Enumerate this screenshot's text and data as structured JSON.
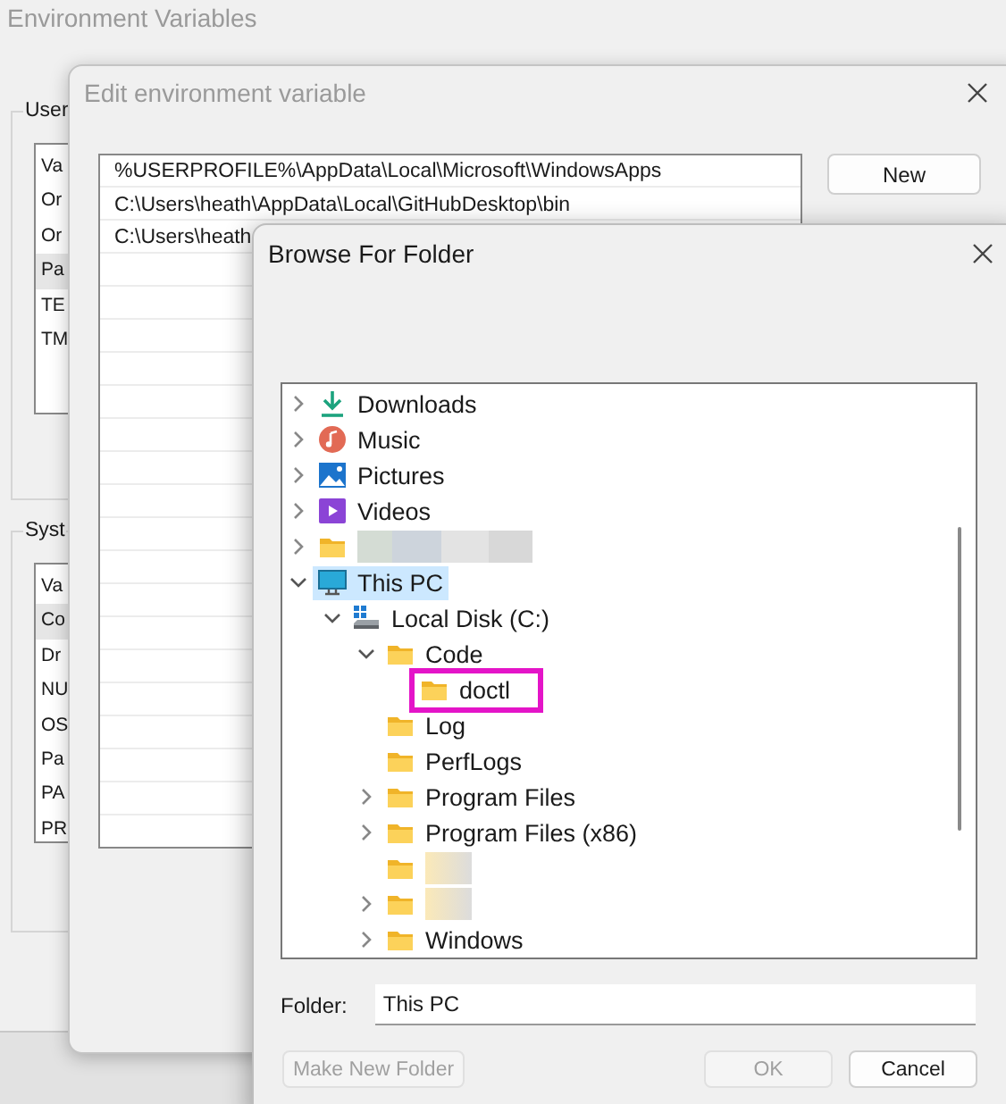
{
  "background_window": {
    "title": "Environment Variables",
    "user_group": {
      "label": "User",
      "header": "Va",
      "rows": [
        {
          "text": "Or",
          "selected": false
        },
        {
          "text": "Or",
          "selected": false
        },
        {
          "text": "Pa",
          "selected": true
        },
        {
          "text": "TE",
          "selected": false
        },
        {
          "text": "TM",
          "selected": false
        }
      ]
    },
    "system_group": {
      "label": "Syst",
      "header": "Va",
      "rows": [
        {
          "text": "Co",
          "selected": true
        },
        {
          "text": "Dr",
          "selected": false
        },
        {
          "text": "NU",
          "selected": false
        },
        {
          "text": "OS",
          "selected": false
        },
        {
          "text": "Pa",
          "selected": false
        },
        {
          "text": "PA",
          "selected": false
        },
        {
          "text": "PR",
          "selected": false
        }
      ]
    }
  },
  "edit_window": {
    "title": "Edit environment variable",
    "entries": [
      {
        "text": "%USERPROFILE%\\AppData\\Local\\Microsoft\\WindowsApps",
        "selected": false
      },
      {
        "text": "C:\\Users\\heath\\AppData\\Local\\GitHubDesktop\\bin",
        "selected": false
      },
      {
        "text": "C:\\Users\\heath",
        "selected": false
      }
    ],
    "buttons": [
      {
        "label": "New",
        "disabled": false
      }
    ]
  },
  "browse_window": {
    "title": "Browse For Folder",
    "tree": [
      {
        "kind": "download",
        "label": "Downloads",
        "expanded": false,
        "selected": false
      },
      {
        "kind": "music",
        "label": "Music",
        "expanded": false,
        "selected": false
      },
      {
        "kind": "pictures",
        "label": "Pictures",
        "expanded": false,
        "selected": false
      },
      {
        "kind": "videos",
        "label": "Videos",
        "expanded": false,
        "selected": false
      },
      {
        "kind": "redacted",
        "expanded": false,
        "selected": false
      },
      {
        "kind": "pc",
        "label": "This PC",
        "expanded": true,
        "selected": true,
        "children": [
          {
            "kind": "drive",
            "label": "Local Disk (C:)",
            "expanded": true,
            "selected": false,
            "children": [
              {
                "kind": "folder",
                "label": "Code",
                "expanded": true,
                "selected": false,
                "children": [
                  {
                    "kind": "folder",
                    "label": "doctl",
                    "selected": false,
                    "highlighted": true
                  }
                ]
              },
              {
                "kind": "folder",
                "label": "Log",
                "selected": false
              },
              {
                "kind": "folder",
                "label": "PerfLogs",
                "selected": false
              },
              {
                "kind": "folder",
                "label": "Program Files",
                "expanded": false,
                "selected": false
              },
              {
                "kind": "folder",
                "label": "Program Files (x86)",
                "expanded": false,
                "selected": false
              },
              {
                "kind": "redacted",
                "selected": false
              },
              {
                "kind": "redacted",
                "expanded": false,
                "selected": false
              },
              {
                "kind": "folder",
                "label": "Windows",
                "expanded": false,
                "selected": false
              }
            ]
          }
        ]
      }
    ],
    "folder_label": "Folder:",
    "folder_value": "This PC",
    "buttons": [
      {
        "label": "Make New Folder",
        "disabled": true
      },
      {
        "label": "OK",
        "disabled": true
      },
      {
        "label": "Cancel",
        "disabled": false
      }
    ]
  }
}
